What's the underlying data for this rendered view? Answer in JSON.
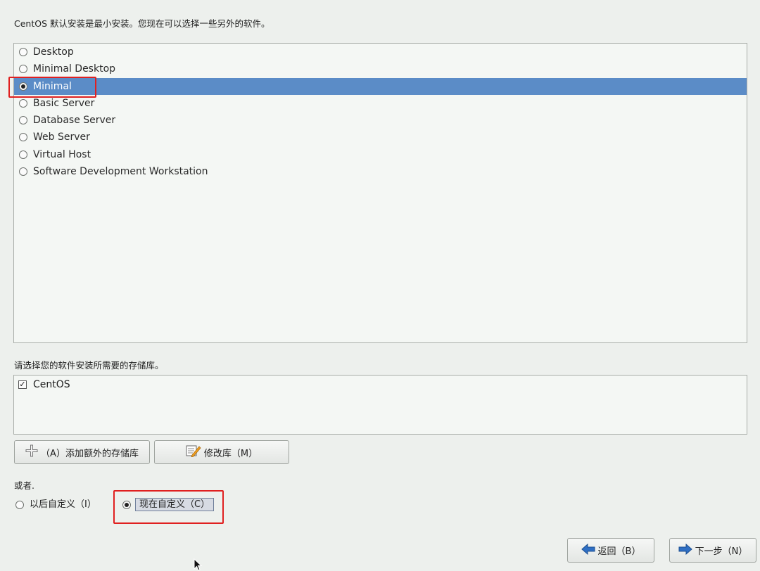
{
  "intro_text": "CentOS 默认安装是最小安装。您现在可以选择一些另外的软件。",
  "install_options": [
    {
      "label": "Desktop",
      "selected": false
    },
    {
      "label": "Minimal Desktop",
      "selected": false
    },
    {
      "label": "Minimal",
      "selected": true
    },
    {
      "label": "Basic Server",
      "selected": false
    },
    {
      "label": "Database Server",
      "selected": false
    },
    {
      "label": "Web Server",
      "selected": false
    },
    {
      "label": "Virtual Host",
      "selected": false
    },
    {
      "label": "Software Development Workstation",
      "selected": false
    }
  ],
  "repo_prompt": "请选择您的软件安装所需要的存储库。",
  "repos": [
    {
      "label": "CentOS",
      "checked": true
    }
  ],
  "buttons": {
    "add_repo": "（A）添加额外的存储库",
    "modify_repo": "修改库（M）",
    "back": "返回（B）",
    "next": "下一步（N）"
  },
  "customize": {
    "or_label": "或者.",
    "later_label": "以后自定义（I）",
    "now_label": "现在自定义（C）",
    "selected": "now"
  },
  "icons": {
    "add": "plus-icon",
    "modify": "edit-pencil-icon",
    "back": "arrow-left-icon",
    "next": "arrow-right-icon"
  },
  "colors": {
    "selection": "#5b8cc7",
    "highlight_annotation": "#e02020",
    "arrow_blue": "#2f6fc4"
  }
}
